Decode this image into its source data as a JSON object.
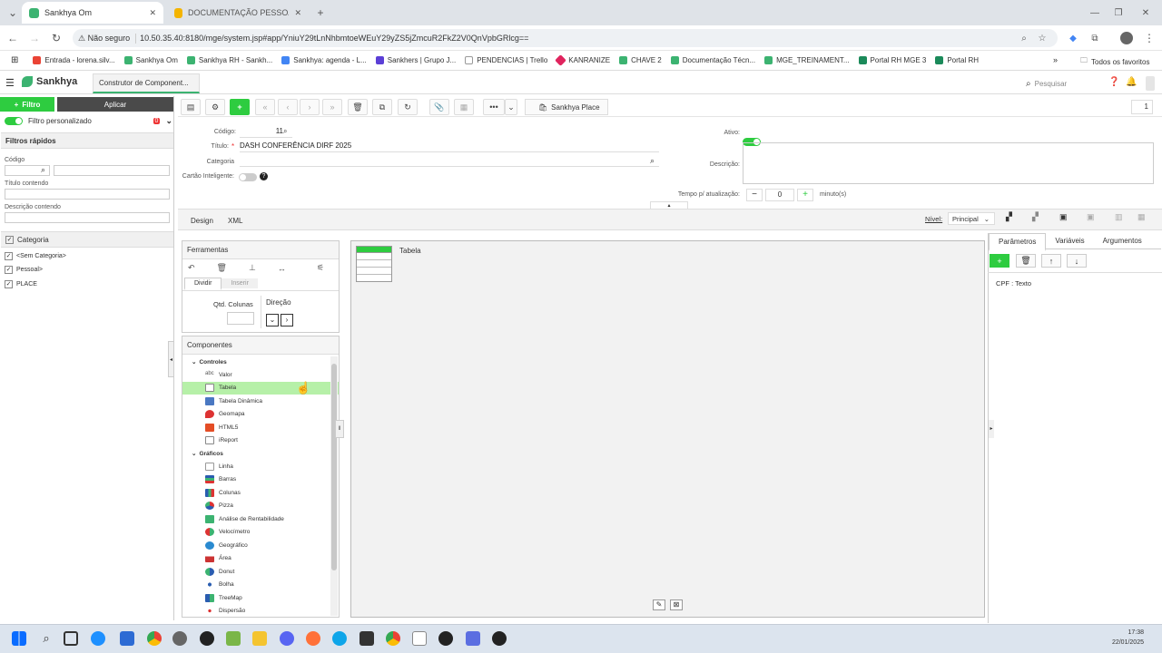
{
  "browser": {
    "tabs": [
      {
        "title": "Sankhya Om"
      },
      {
        "title": "DOCUMENTAÇÃO PESSOAL - G"
      }
    ],
    "security_label": "Não seguro",
    "url": "10.50.35.40:8180/mge/system.jsp#app/YniuY29tLnNhbmtoeWEuY29yZS5jZmcuR2FkZ2V0QnVpbGRlcg==",
    "bookmarks": [
      "Entrada - lorena.silv...",
      "Sankhya Om",
      "Sankhya RH - Sankh...",
      "Sankhya: agenda - L...",
      "Sankhers | Grupo J...",
      "PENDENCIAS | Trello",
      "KANRANIZE",
      "CHAVE 2",
      "Documentação Técn...",
      "MGE_TREINAMENT...",
      "Portal RH MGE 3",
      "Portal RH"
    ],
    "favorites_label": "Todos os favoritos"
  },
  "app": {
    "logo": "Sankhya",
    "tab_title": "Construtor de Component...",
    "search_placeholder": "Pesquisar"
  },
  "sidebar": {
    "filtro_label": "Filtro",
    "aplicar_label": "Aplicar",
    "custom_filter_label": "Filtro personalizado",
    "custom_filter_badge": "0",
    "quick_filters_title": "Filtros rápidos",
    "codigo_label": "Código",
    "titulo_label": "Título contendo",
    "descricao_label": "Descrição contendo",
    "categoria_title": "Categoria",
    "categorias": [
      "<Sem Categoria>",
      "Pessoal>",
      "PLACE"
    ]
  },
  "toolbar": {
    "place_label": "Sankhya Place",
    "page_number": "1"
  },
  "form": {
    "codigo_label": "Código:",
    "codigo_value": "11",
    "titulo_label": "Título:",
    "titulo_value": "DASH CONFERÊNCIA DIRF 2025",
    "categoria_label": "Categoria",
    "cartao_label": "Cartão Inteligente:",
    "ativo_label": "Ativo:",
    "descricao_label": "Descrição:",
    "tempo_label": "Tempo p/ atualização:",
    "tempo_value": "0",
    "tempo_unit": "minuto(s)"
  },
  "design": {
    "tabs": [
      "Design",
      "XML"
    ],
    "nivel_label": "Nível:",
    "nivel_value": "Principal"
  },
  "ferramentas": {
    "title": "Ferramentas",
    "tabs": [
      "Dividir",
      "Inserir"
    ],
    "qtd_label": "Qtd. Colunas",
    "direcao_label": "Direção"
  },
  "componentes": {
    "title": "Componentes",
    "groups": [
      {
        "name": "Controles",
        "items": [
          "Valor",
          "Tabela",
          "Tabela Dinâmica",
          "Geomapa",
          "HTML5",
          "iReport"
        ]
      },
      {
        "name": "Gráficos",
        "items": [
          "Linha",
          "Barras",
          "Colunas",
          "Pizza",
          "Análise de Rentabilidade",
          "Velocímetro",
          "Geográfico",
          "Área",
          "Donut",
          "Bolha",
          "TreeMap",
          "Dispersão"
        ]
      }
    ]
  },
  "canvas": {
    "widget_label": "Tabela"
  },
  "right_panel": {
    "tabs": [
      "Parâmetros",
      "Variáveis",
      "Argumentos"
    ],
    "params": [
      "CPF : Texto"
    ]
  },
  "taskbar": {
    "time": "17:38",
    "date": "22/01/2025"
  },
  "colors": {
    "accent_green": "#2ecc40",
    "selected_row": "#b6f0a8"
  }
}
